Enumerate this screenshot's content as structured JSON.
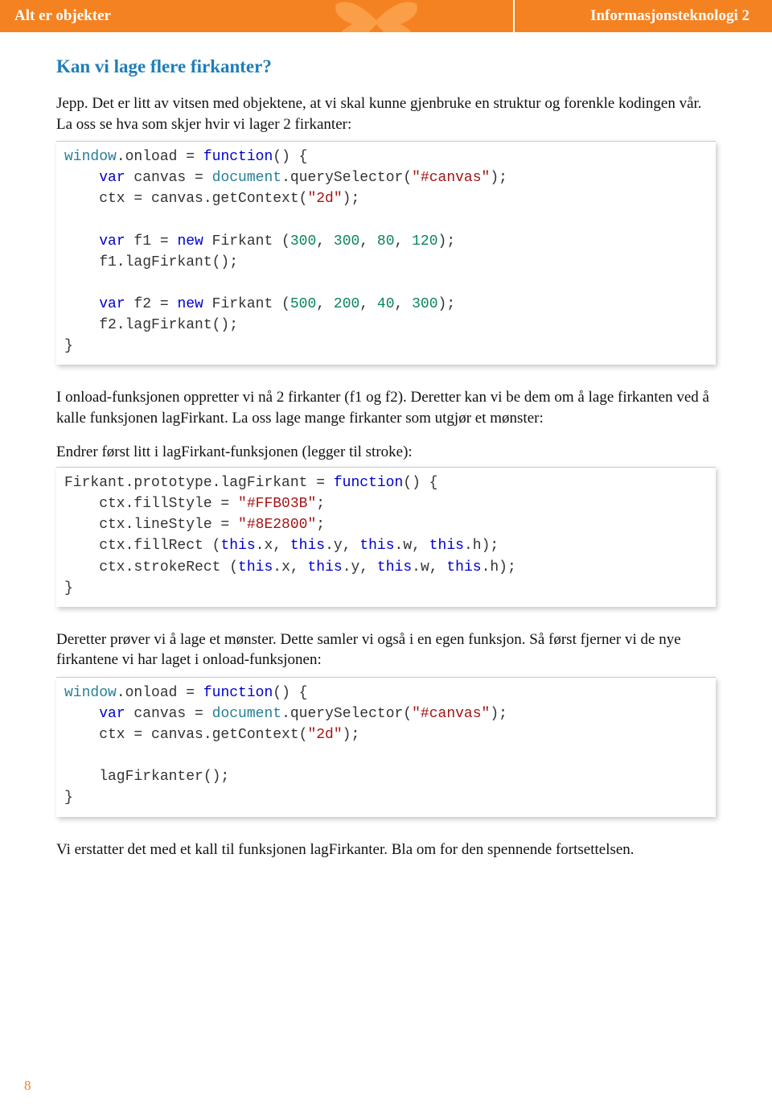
{
  "header": {
    "left": "Alt er objekter",
    "right": "Informasjonsteknologi 2"
  },
  "section_title": "Kan vi lage flere firkanter?",
  "para1": "Jepp. Det er litt av vitsen med objektene, at vi skal kunne gjenbruke en struktur og forenkle kodingen vår. La oss se hva som skjer hvir vi lager 2 firkanter:",
  "code1": {
    "l1a": "window",
    "l1b": ".onload = ",
    "l1c": "function",
    "l1d": "() {",
    "l2a": "    ",
    "l2b": "var",
    "l2c": " canvas = ",
    "l2d": "document",
    "l2e": ".querySelector(",
    "l2f": "\"#canvas\"",
    "l2g": ");",
    "l3a": "    ctx = canvas.getContext(",
    "l3b": "\"2d\"",
    "l3c": ");",
    "l4": "",
    "l5a": "    ",
    "l5b": "var",
    "l5c": " f1 = ",
    "l5d": "new",
    "l5e": " Firkant (",
    "l5f": "300",
    "l5g": ", ",
    "l5h": "300",
    "l5i": ", ",
    "l5j": "80",
    "l5k": ", ",
    "l5l": "120",
    "l5m": ");",
    "l6": "    f1.lagFirkant();",
    "l7": "",
    "l8a": "    ",
    "l8b": "var",
    "l8c": " f2 = ",
    "l8d": "new",
    "l8e": " Firkant (",
    "l8f": "500",
    "l8g": ", ",
    "l8h": "200",
    "l8i": ", ",
    "l8j": "40",
    "l8k": ", ",
    "l8l": "300",
    "l8m": ");",
    "l9": "    f2.lagFirkant();",
    "l10": "}"
  },
  "para2": "I onload-funksjonen oppretter vi nå 2 firkanter (f1 og f2). Deretter kan vi be dem om å lage firkanten ved å kalle funksjonen lagFirkant. La oss lage mange firkanter som utgjør et mønster:",
  "para3": "Endrer først litt i lagFirkant-funksjonen (legger til stroke):",
  "code2": {
    "l1a": "Firkant.prototype.lagFirkant = ",
    "l1b": "function",
    "l1c": "() {",
    "l2a": "    ctx.fillStyle = ",
    "l2b": "\"#FFB03B\"",
    "l2c": ";",
    "l3a": "    ctx.lineStyle = ",
    "l3b": "\"#8E2800\"",
    "l3c": ";",
    "l4a": "    ctx.fillRect (",
    "l4b": "this",
    "l4c": ".x, ",
    "l4d": "this",
    "l4e": ".y, ",
    "l4f": "this",
    "l4g": ".w, ",
    "l4h": "this",
    "l4i": ".h);",
    "l5a": "    ctx.strokeRect (",
    "l5b": "this",
    "l5c": ".x, ",
    "l5d": "this",
    "l5e": ".y, ",
    "l5f": "this",
    "l5g": ".w, ",
    "l5h": "this",
    "l5i": ".h);",
    "l6": "}"
  },
  "para4": "Deretter prøver vi å lage et mønster. Dette samler vi også i en egen funksjon. Så først fjerner vi de nye firkantene vi har laget i onload-funksjonen:",
  "code3": {
    "l1a": "window",
    "l1b": ".onload = ",
    "l1c": "function",
    "l1d": "() {",
    "l2a": "    ",
    "l2b": "var",
    "l2c": " canvas = ",
    "l2d": "document",
    "l2e": ".querySelector(",
    "l2f": "\"#canvas\"",
    "l2g": ");",
    "l3a": "    ctx = canvas.getContext(",
    "l3b": "\"2d\"",
    "l3c": ");",
    "l4": "",
    "l5": "    lagFirkanter();",
    "l6": "}"
  },
  "para5": "Vi erstatter det med et kall til funksjonen lagFirkanter. Bla om for den spennende fortsettelsen.",
  "page_number": "8"
}
